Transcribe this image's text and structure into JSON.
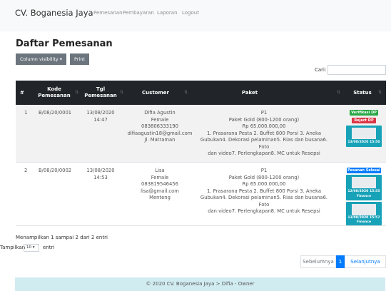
{
  "navbar": {
    "brand": "CV. Boganesia Jaya",
    "links": [
      "Pemesanan",
      "Pembayaran",
      "Laporan",
      "Logout"
    ]
  },
  "page": {
    "title": "Daftar Pemesanan",
    "buttons": {
      "column_visibility": "Column visibility ▾",
      "print": "Print"
    },
    "search_label": "Cari:"
  },
  "table": {
    "headers": [
      "#",
      "Kode Pemesanan",
      "Tgl Pemesanan",
      "Customer",
      "Paket",
      "Status"
    ],
    "rows": [
      {
        "no": "1",
        "kode": "B/08/20/0001",
        "tgl_date": "13/08/2020",
        "tgl_time": "14:47",
        "customer": [
          "Difia Agustin",
          "Female",
          "083806333190",
          "difiaagustin18@gmail.com",
          "Jl. Matraman"
        ],
        "paket": [
          "P1",
          "Paket Gold (800-1200 orang)",
          "Rp 65.000.000,00",
          "1. Prasarana Pesta 2. Buffet 800 Porsi 3. Aneka",
          "Gubukan4. Dekorasi pelaminan5. Rias dan busana6. Foto",
          "dan video7. Perlengkapan8. MC untuk Resepsi"
        ],
        "status": {
          "badges": [
            "Verifikasi DP",
            "Reject DP"
          ],
          "proofs": [
            "13/08/2020 15:50"
          ]
        }
      },
      {
        "no": "2",
        "kode": "B/08/20/0002",
        "tgl_date": "13/08/2020",
        "tgl_time": "14:53",
        "customer": [
          "Lisa",
          "Female",
          "083819546456",
          "lisa@gmail.com",
          "Menteng"
        ],
        "paket": [
          "P1",
          "Paket Gold (800-1200 orang)",
          "Rp 65.000.000,00",
          "1. Prasarana Pesta 2. Buffet 800 Porsi 3. Aneka",
          "Gubukan4. Dekorasi pelaminan5. Rias dan busana6. Foto",
          "dan video7. Perlengkapan8. MC untuk Resepsi"
        ],
        "status": {
          "badges": [
            "Pesanan Selesai"
          ],
          "proofs": [
            "12/08/2020 15:55",
            "13/08/2020 15:57"
          ],
          "proof_label": "Finance"
        }
      }
    ]
  },
  "info": {
    "summary": "Menampilkan 1 sampai 2 dari 2 entri",
    "show_prefix": "Tampilkan",
    "show_value": "10 ▾",
    "show_suffix": "entri"
  },
  "pagination": {
    "prev": "Sebelumnya",
    "current": "1",
    "next": "Selanjutnya"
  },
  "footer": {
    "copyright": "© 2020 CV. Boganesia Jaya > Difia - Owner"
  },
  "colors": {
    "verify": "#28a745",
    "reject": "#dc3545",
    "done": "#007bff",
    "proof": "#17a2b8",
    "header": "#212529"
  }
}
